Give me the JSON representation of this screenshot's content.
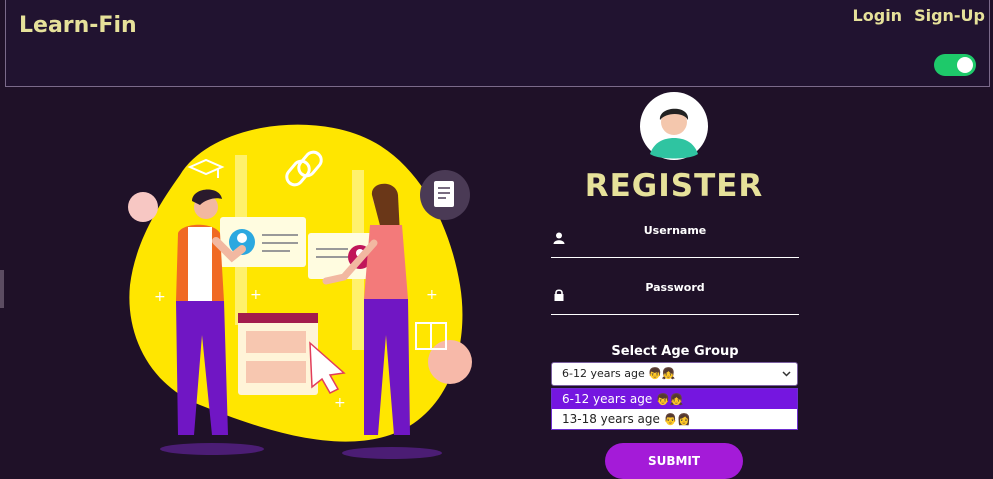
{
  "header": {
    "brand": "Learn-Fin",
    "login_label": "Login",
    "signup_label": "Sign-Up",
    "theme_toggle_on": true
  },
  "form": {
    "title": "REGISTER",
    "username_label": "Username",
    "password_label": "Password",
    "age_group_label": "Select Age Group",
    "age_selected": "6-12 years age",
    "age_options": [
      {
        "label": "6-12 years age",
        "emoji": "👦👧",
        "selected": true
      },
      {
        "label": "13-18 years age",
        "emoji": "👨👩",
        "selected": false
      }
    ],
    "submit_label": "SUBMIT"
  },
  "colors": {
    "background": "#1f1128",
    "brand_text": "#e6e19a",
    "toggle_on": "#1ec96a",
    "option_highlight": "#7516e0",
    "submit_button": "#a41bd8",
    "illustration_blob": "#ffe600"
  },
  "icons": [
    "user-icon",
    "lock-icon",
    "chevron-down-icon",
    "avatar-icon"
  ]
}
